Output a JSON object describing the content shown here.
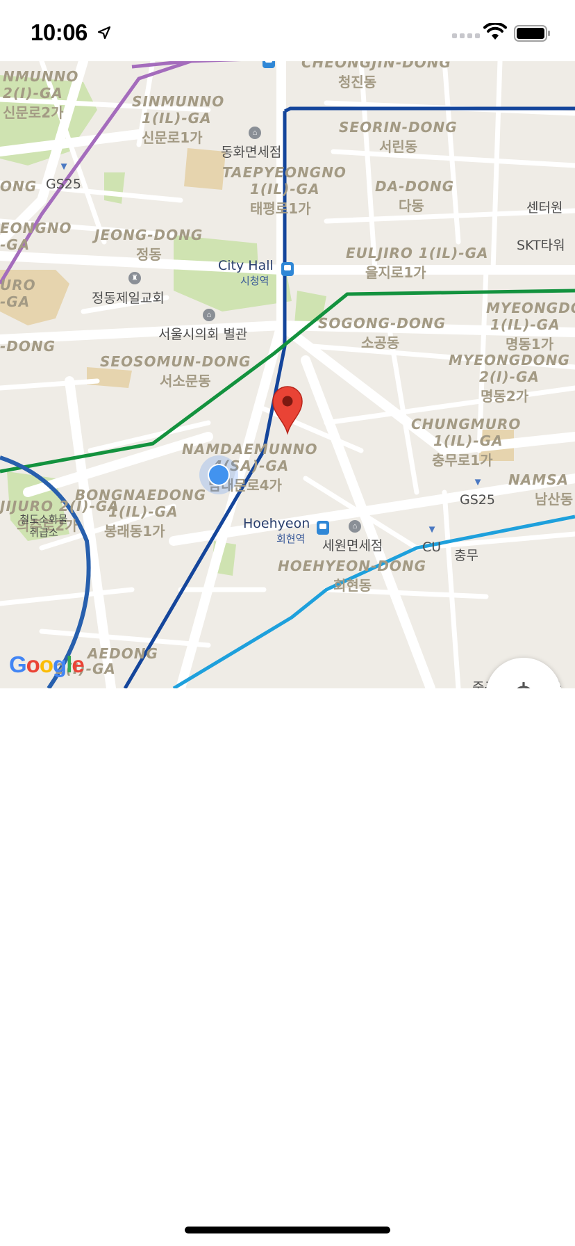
{
  "status_bar": {
    "time": "10:06",
    "location_icon": "location-arrow-icon",
    "wifi_icon": "wifi-icon",
    "battery_icon": "battery-icon"
  },
  "map": {
    "attribution": "Google",
    "areas": [
      {
        "en": "NMUNNO",
        "ko": ""
      },
      {
        "en": "2(I)-GA",
        "ko": "신문로2가"
      },
      {
        "en": "SINMUNNO",
        "ko": ""
      },
      {
        "en": "1(IL)-GA",
        "ko": "신문로1가"
      },
      {
        "en": "CHEONGJIN-DONG",
        "ko": "청진동"
      },
      {
        "en": "SEORIN-DONG",
        "ko": "서린동"
      },
      {
        "en": "TAEPYEONGNO",
        "ko": ""
      },
      {
        "en": "1(IL)-GA",
        "ko": "태평로1가"
      },
      {
        "en": "DA-DONG",
        "ko": "다동"
      },
      {
        "en": "JEONG-DONG",
        "ko": "정동"
      },
      {
        "en": "EULJIRO 1(IL)-GA",
        "ko": "을지로1가"
      },
      {
        "en": "SOGONG-DONG",
        "ko": "소공동"
      },
      {
        "en": "MYEONGDON",
        "ko": ""
      },
      {
        "en": "1(IL)-GA",
        "ko": "명동1가"
      },
      {
        "en": "MYEONGDONG",
        "ko": ""
      },
      {
        "en": "2(I)-GA",
        "ko": "명동2가"
      },
      {
        "en": "SEOSOMUN-DONG",
        "ko": "서소문동"
      },
      {
        "en": "CHUNGMURO",
        "ko": ""
      },
      {
        "en": "1(IL)-GA",
        "ko": "충무로1가"
      },
      {
        "en": "NAMDAEMUNNO",
        "ko": ""
      },
      {
        "en": "4(SA)-GA",
        "ko": "남대문로4가"
      },
      {
        "en": "BONGNAEDONG",
        "ko": ""
      },
      {
        "en": "1(IL)-GA",
        "ko": "봉래동1가"
      },
      {
        "en": "NAMSA",
        "ko": "남산동"
      },
      {
        "en": "HOEHYEON-DONG",
        "ko": "회현동"
      },
      {
        "en": "EONGNO",
        "ko": ""
      },
      {
        "en": "-GA",
        "ko": ""
      },
      {
        "en": "URO",
        "ko": ""
      },
      {
        "en": "-GA",
        "ko": ""
      },
      {
        "en": "-DONG",
        "ko": ""
      },
      {
        "en": "JIJURO 2(I)-GA",
        "ko": "의주로2가"
      },
      {
        "en": "AEDONG",
        "ko": ""
      },
      {
        "en": "2(I)-GA",
        "ko": ""
      },
      {
        "en": "ONG",
        "ko": ""
      }
    ],
    "pois": [
      {
        "label": "동화면세점",
        "icon": "shopping-bag-icon"
      },
      {
        "label": "GS25",
        "icon": "shopping-cart-icon"
      },
      {
        "label": "센터원",
        "icon": ""
      },
      {
        "label": "SKT타워",
        "icon": ""
      },
      {
        "label": "정동제일교회",
        "icon": "church-icon"
      },
      {
        "label": "서울시의회 별관",
        "icon": "government-building-icon"
      },
      {
        "label": "GS25",
        "icon": "shopping-cart-icon"
      },
      {
        "label": "세원면세점",
        "icon": "shopping-bag-icon"
      },
      {
        "label": "CU",
        "icon": "shopping-cart-icon"
      },
      {
        "label": "충무",
        "icon": ""
      },
      {
        "label": "철도소화물 취급소",
        "icon": ""
      },
      {
        "label": "중구대사관 영사",
        "icon": ""
      }
    ],
    "stations": [
      {
        "en": "City Hall",
        "ko": "시청역",
        "icon": "subway-station-icon"
      },
      {
        "en": "Hoehyeon",
        "ko": "회현역",
        "icon": "subway-station-icon"
      }
    ],
    "marker_icon": "map-pin-icon",
    "user_location_icon": "current-location-dot",
    "locate_button_icon": "my-location-crosshair-icon"
  }
}
